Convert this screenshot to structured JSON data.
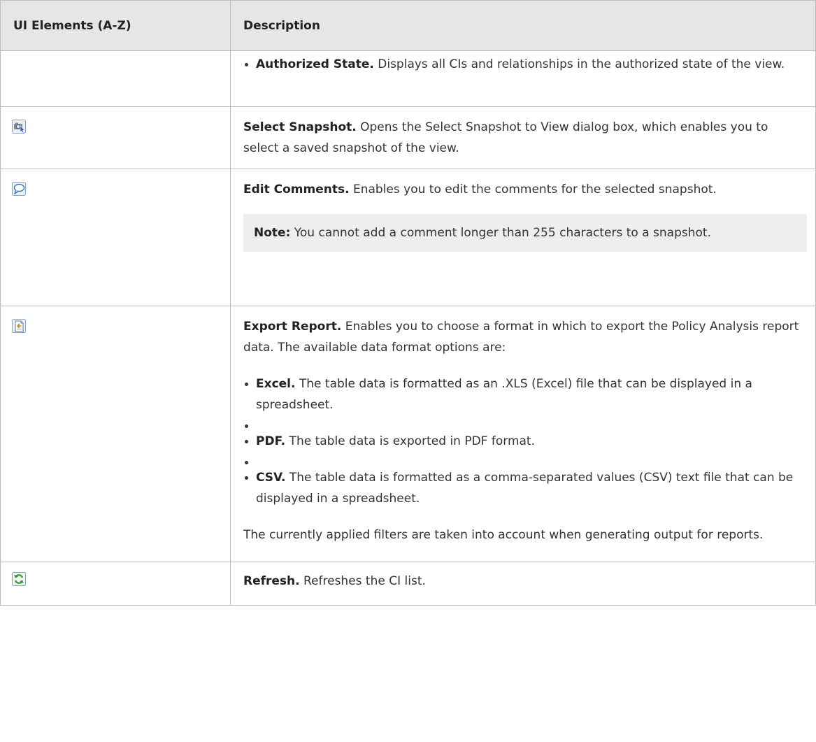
{
  "header": {
    "col1": "UI Elements (A-Z)",
    "col2": "Description"
  },
  "rows": {
    "authorized": {
      "title": "Authorized State.",
      "text": " Displays all CIs and relationships in the authorized state of the view."
    },
    "select_snapshot": {
      "icon": "camera-select-icon",
      "title": "Select Snapshot.",
      "text": " Opens the Select Snapshot to View dialog box, which enables you to select a saved snapshot of the view."
    },
    "edit_comments": {
      "icon": "speech-bubble-icon",
      "title": "Edit Comments.",
      "text": " Enables you to edit the comments for the selected snapshot.",
      "note_label": "Note:",
      "note_text": " You cannot add a comment longer than 255 characters to a snapshot."
    },
    "export_report": {
      "icon": "export-document-icon",
      "title": "Export Report.",
      "text": " Enables you to choose a format in which to export the Policy Analysis report data. The available data format options are:",
      "options": [
        {
          "title": "Excel.",
          "text": " The table data is formatted as an .XLS (Excel) file that can be displayed in a spreadsheet."
        },
        {
          "title": "PDF.",
          "text": " The table data is exported in PDF format."
        },
        {
          "title": "CSV.",
          "text": " The table data is formatted as a comma-separated values (CSV) text file that can be displayed in a spreadsheet."
        }
      ],
      "footer": "The currently applied filters are taken into account when generating output for reports."
    },
    "refresh": {
      "icon": "refresh-icon",
      "title": "Refresh.",
      "text": " Refreshes the CI list."
    }
  }
}
